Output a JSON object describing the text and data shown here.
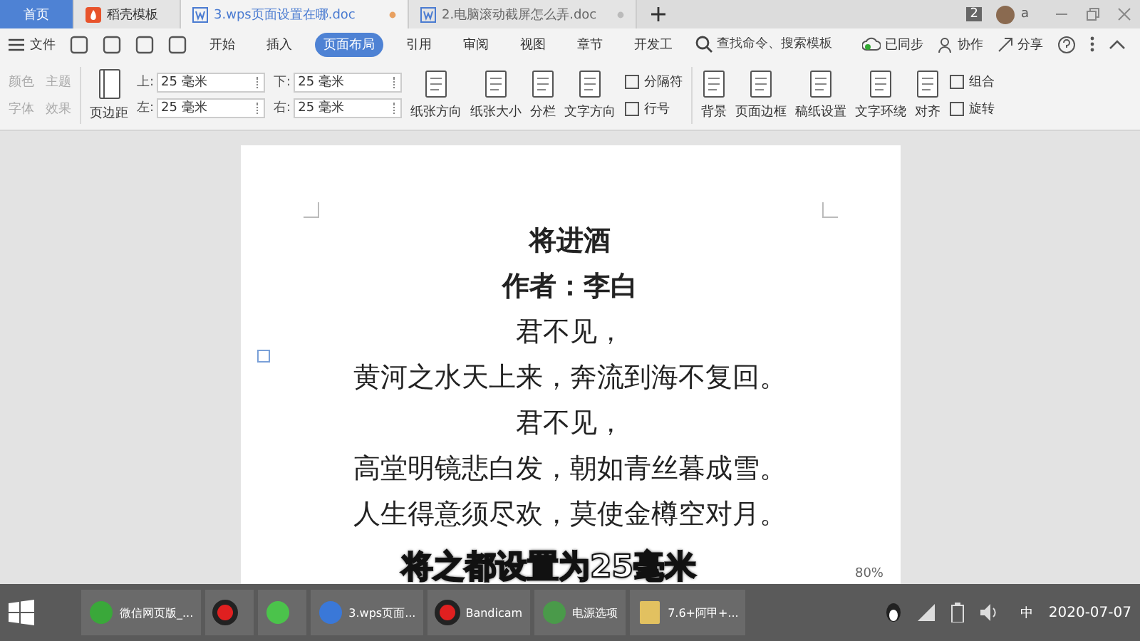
{
  "tabs": [
    {
      "label": "首页",
      "kind": "home",
      "selected": false
    },
    {
      "label": "稻壳模板",
      "kind": "template",
      "selected": false
    },
    {
      "label": "3.wps页面设置在哪.doc",
      "kind": "doc",
      "selected": true
    },
    {
      "label": "2.电脑滚动截屏怎么弄.doc",
      "kind": "doc",
      "selected": false
    }
  ],
  "window_badge": "2",
  "user": "a",
  "menu": {
    "file": "文件",
    "ribbon_tabs": [
      {
        "label": "开始",
        "selected": false
      },
      {
        "label": "插入",
        "selected": false
      },
      {
        "label": "页面布局",
        "selected": true
      },
      {
        "label": "引用",
        "selected": false
      },
      {
        "label": "审阅",
        "selected": false
      },
      {
        "label": "视图",
        "selected": false
      },
      {
        "label": "章节",
        "selected": false
      },
      {
        "label": "开发工",
        "selected": false
      }
    ],
    "search": {
      "placeholder": "查找命令、搜索模板"
    },
    "sync": "已同步",
    "collab": "协作",
    "share": "分享"
  },
  "ribbon": {
    "theme": [
      {
        "label": "颜色",
        "disabled": true
      },
      {
        "label": "主题",
        "disabled": true
      },
      {
        "label": "字体",
        "disabled": true
      },
      {
        "label": "效果",
        "disabled": true
      }
    ],
    "margins_button": "页边距",
    "margins": [
      {
        "label": "上:",
        "value": "25 毫米"
      },
      {
        "label": "下:",
        "value": "25 毫米"
      },
      {
        "label": "左:",
        "value": "25 毫米"
      },
      {
        "label": "右:",
        "value": "25 毫米"
      }
    ],
    "buttons": [
      {
        "label": "纸张方向",
        "kind": "big"
      },
      {
        "label": "纸张大小",
        "kind": "big"
      },
      {
        "label": "分栏",
        "kind": "big"
      },
      {
        "label": "文字方向",
        "kind": "big"
      },
      {
        "label": "分隔符",
        "kind": "small"
      },
      {
        "label": "行号",
        "kind": "small"
      },
      {
        "label": "背景",
        "kind": "big"
      },
      {
        "label": "页面边框",
        "kind": "big"
      },
      {
        "label": "稿纸设置",
        "kind": "big"
      },
      {
        "label": "文字环绕",
        "kind": "big"
      },
      {
        "label": "对齐",
        "kind": "big"
      },
      {
        "label": "组合",
        "kind": "small"
      },
      {
        "label": "旋转",
        "kind": "small"
      }
    ]
  },
  "document": {
    "lines": [
      {
        "text": "将进酒",
        "kind": "title"
      },
      {
        "text": "作者：李白",
        "kind": "title"
      },
      {
        "text": "君不见，",
        "kind": "verse"
      },
      {
        "text": "黄河之水天上来，奔流到海不复回。",
        "kind": "verse"
      },
      {
        "text": "君不见，",
        "kind": "verse"
      },
      {
        "text": "高堂明镜悲白发，朝如青丝暮成雪。",
        "kind": "verse"
      },
      {
        "text": "人生得意须尽欢，莫使金樽空对月。",
        "kind": "verse"
      }
    ]
  },
  "caption": "将之都设置为25毫米",
  "status_bar": {
    "zoom": "80%"
  },
  "taskbar": {
    "items": [
      {
        "label": "微信网页版_...",
        "kind": "browser"
      },
      {
        "kind": "record"
      },
      {
        "kind": "chat"
      },
      {
        "label": "3.wps页面...",
        "kind": "wps"
      },
      {
        "label": "Bandicam",
        "kind": "record"
      },
      {
        "label": "电源选项",
        "kind": "power"
      },
      {
        "label": "7.6+阿甲+...",
        "kind": "folder"
      }
    ],
    "ime": "中",
    "date": "2020-07-07"
  }
}
